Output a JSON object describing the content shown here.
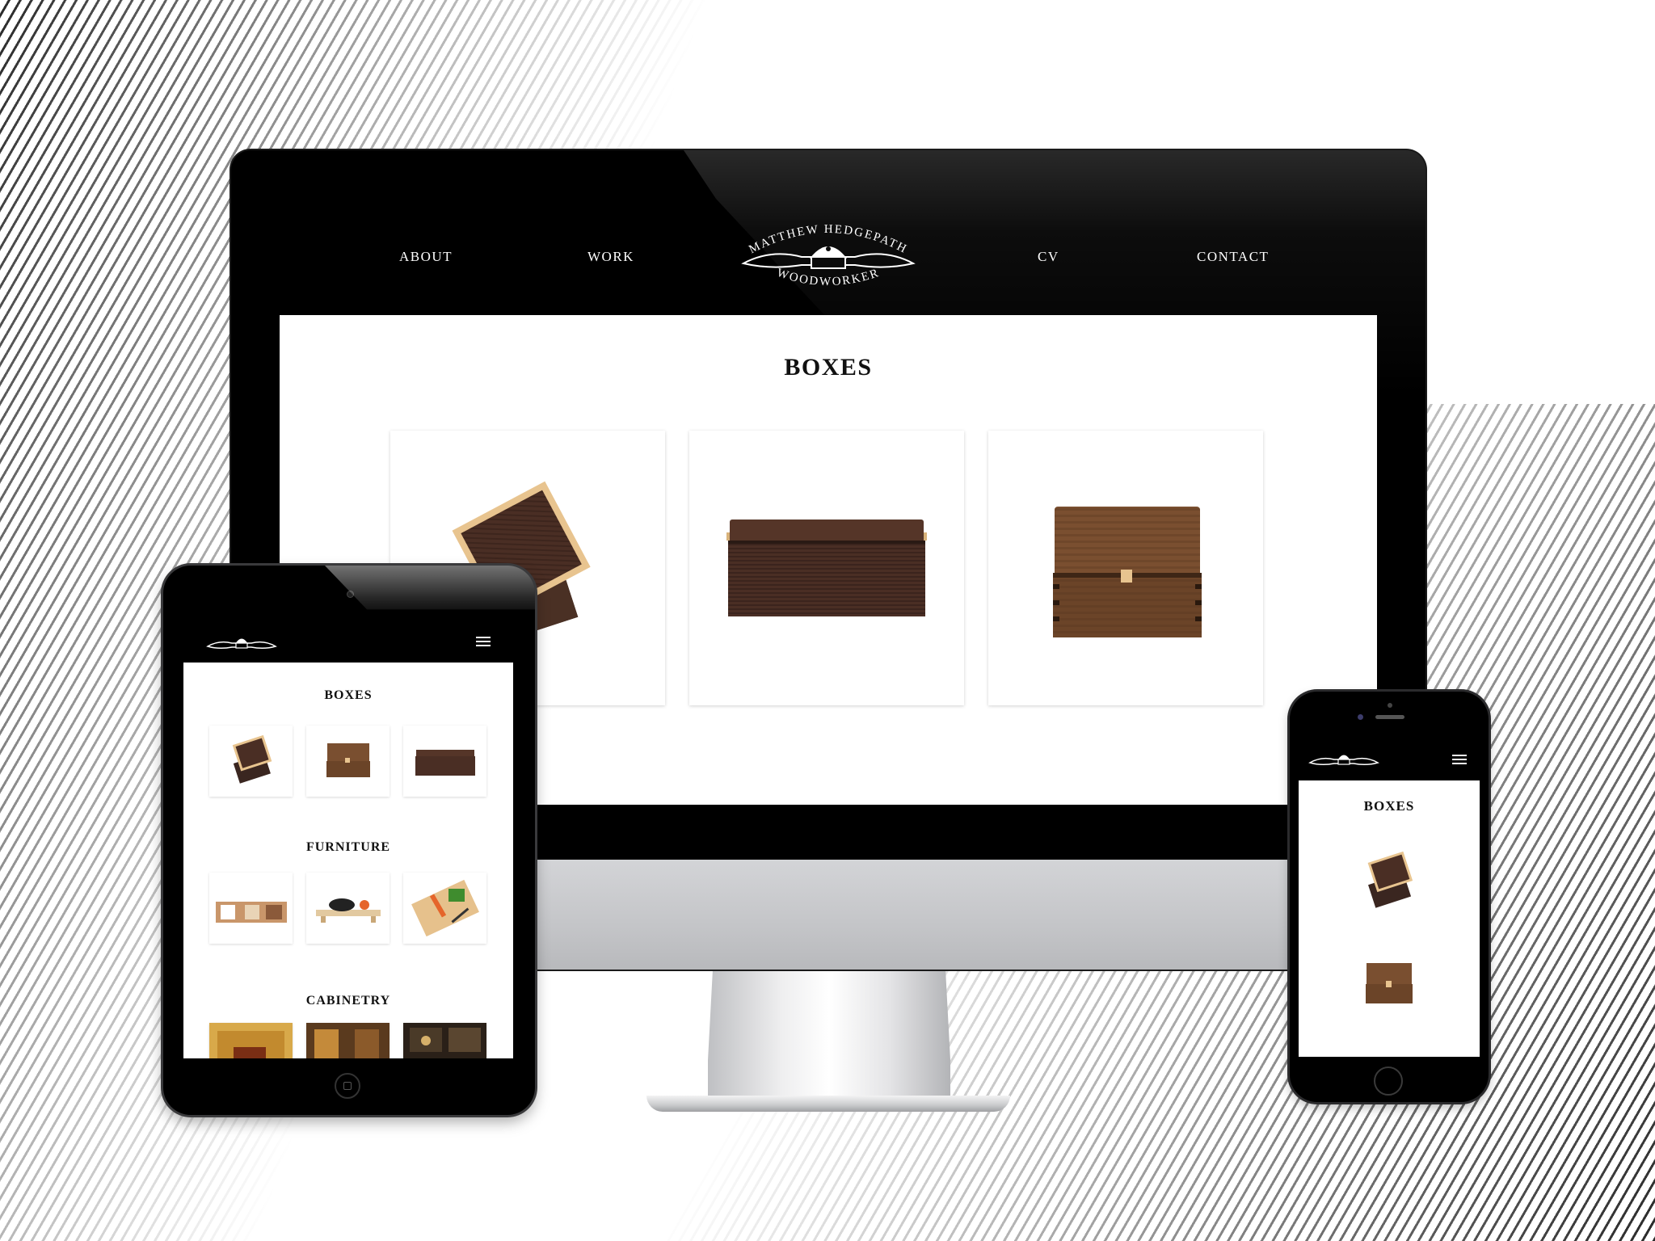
{
  "desktop": {
    "nav": {
      "items": [
        "ABOUT",
        "WORK",
        "CV",
        "CONTACT"
      ],
      "logo": {
        "top_text": "MATTHEW HEDGEPATH",
        "bottom_text": "WOODWORKER"
      }
    },
    "section_title": "BOXES",
    "cards": [
      {
        "subject": "tilted wenge box with maple lid"
      },
      {
        "subject": "long wenge box"
      },
      {
        "subject": "walnut box with dovetail corners"
      }
    ]
  },
  "tablet": {
    "sections": [
      {
        "title": "BOXES"
      },
      {
        "title": "FURNITURE"
      },
      {
        "title": "CABINETRY"
      }
    ]
  },
  "phone": {
    "section_title": "BOXES"
  },
  "icons": [
    "spokeshave-logo-icon",
    "hamburger-menu-icon",
    "home-button-icon"
  ],
  "colors": {
    "nav_bg": "#000000",
    "page_bg": "#ffffff",
    "wood_wenge": "#4a2e24",
    "wood_walnut": "#6b4428",
    "wood_maple": "#e8c48f"
  }
}
